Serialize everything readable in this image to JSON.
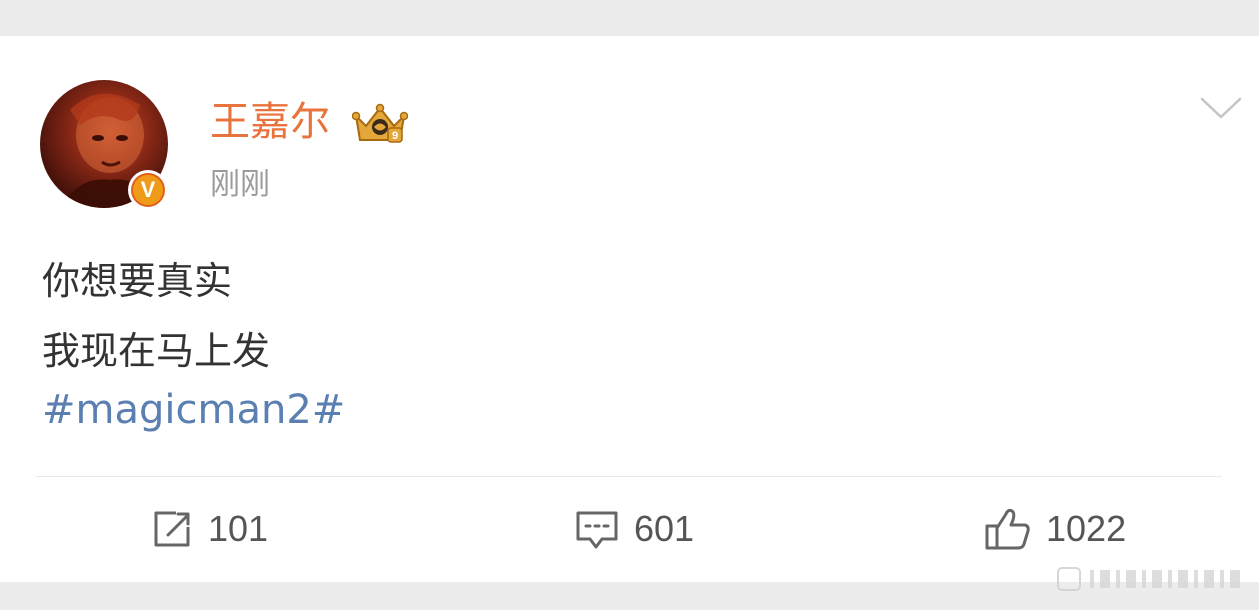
{
  "post": {
    "author": {
      "name": "王嘉尔",
      "verified": true,
      "verified_badge_letter": "V",
      "vip_icon": "crown-icon"
    },
    "timestamp": "刚刚",
    "content_lines": [
      "你想要真实",
      "我现在马上发"
    ],
    "hashtag": "#magicman2#"
  },
  "actions": {
    "repost_count": "101",
    "comment_count": "601",
    "like_count": "1022"
  },
  "colors": {
    "username": "#e8733c",
    "hashtag": "#5a7fb0",
    "verified": "#f09a1a",
    "timestamp": "#9b9b9b",
    "text": "#333333"
  }
}
